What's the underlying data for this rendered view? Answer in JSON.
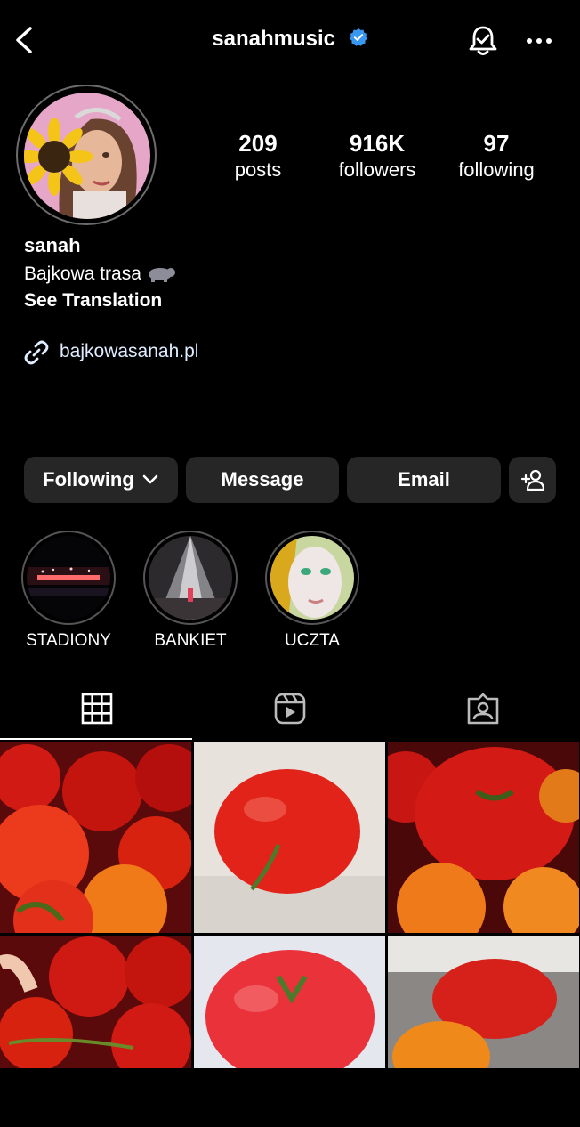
{
  "header": {
    "username": "sanahmusic"
  },
  "profile": {
    "posts_count": "209",
    "posts_label": "posts",
    "followers_count": "916K",
    "followers_label": "followers",
    "following_count": "97",
    "following_label": "following",
    "name": "sanah",
    "bio": "Bajkowa trasa",
    "bio_emoji_icon": "hippo-icon",
    "see_translation": "See Translation",
    "link": "bajkowasanah.pl"
  },
  "actions": {
    "following": "Following",
    "message": "Message",
    "email": "Email"
  },
  "highlights": [
    {
      "label": "STADIONY"
    },
    {
      "label": "BANKIET"
    },
    {
      "label": "UCZTA"
    }
  ],
  "tabs": [
    "grid-icon",
    "reels-icon",
    "tagged-icon"
  ],
  "colors": {
    "background": "#000000",
    "button": "#262626",
    "verified": "#3897f0"
  }
}
